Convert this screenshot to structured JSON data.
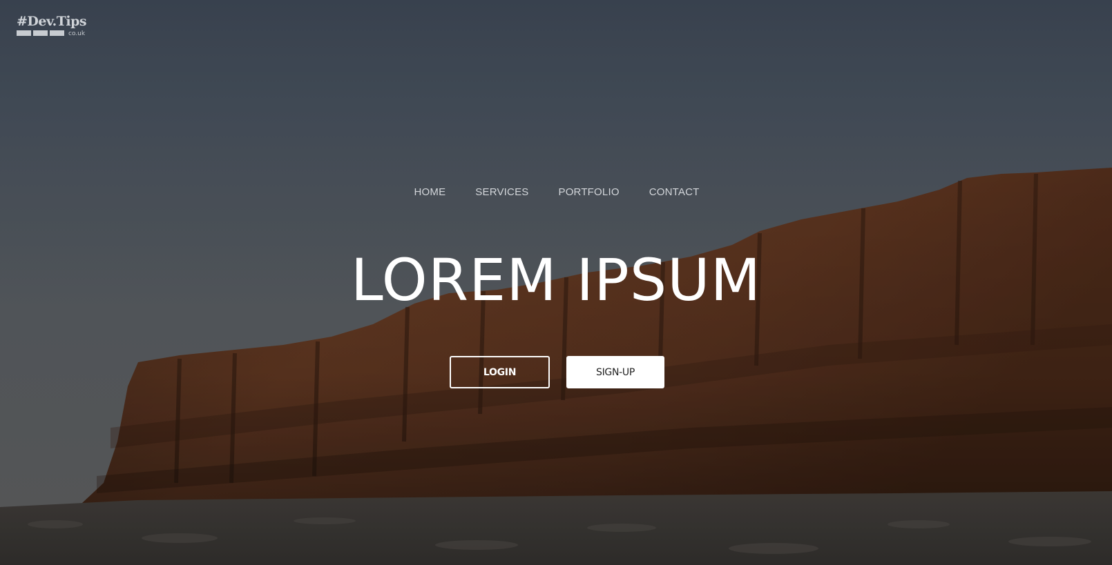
{
  "logo": {
    "text": "#Dev.Tips",
    "sub": "co.uk"
  },
  "nav": {
    "items": [
      {
        "label": "HOME"
      },
      {
        "label": "SERVICES"
      },
      {
        "label": "PORTFOLIO"
      },
      {
        "label": "CONTACT"
      }
    ]
  },
  "hero": {
    "title": "LOREM IPSUM",
    "login_label": "LOGIN",
    "signup_label": "SIGN-UP"
  },
  "colors": {
    "sky_top": "#3b4452",
    "sky_bottom": "#5a5a5b",
    "rock": "#5b3320",
    "text": "#ffffff"
  }
}
